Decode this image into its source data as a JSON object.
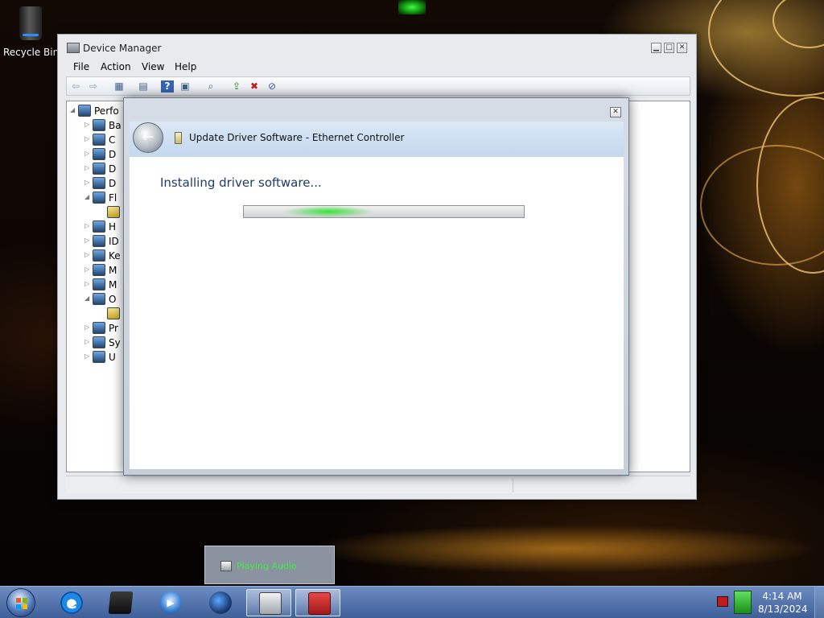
{
  "desktop": {
    "icons": [
      {
        "label": "Recycle Bin",
        "icon": "recycle-bin-icon"
      }
    ]
  },
  "device_manager": {
    "title": "Device Manager",
    "menu": [
      "File",
      "Action",
      "View",
      "Help"
    ],
    "toolbar_icons": [
      "back-arrow-icon",
      "forward-arrow-icon",
      "show-hide-tree-icon",
      "properties-icon",
      "help-icon",
      "console-tree-icon",
      "scan-hardware-icon",
      "update-driver-icon",
      "uninstall-icon",
      "disable-icon"
    ],
    "tree": [
      {
        "label": "Perfo",
        "level": 0,
        "expander": "expanded"
      },
      {
        "label": "Ba",
        "level": 1,
        "expander": "collapsed"
      },
      {
        "label": "C",
        "level": 1,
        "expander": "collapsed"
      },
      {
        "label": "D",
        "level": 1,
        "expander": "collapsed"
      },
      {
        "label": "D",
        "level": 1,
        "expander": "collapsed"
      },
      {
        "label": "D",
        "level": 1,
        "expander": "collapsed"
      },
      {
        "label": "Fl",
        "level": 1,
        "expander": "expanded"
      },
      {
        "label": "",
        "level": 2,
        "expander": "none"
      },
      {
        "label": "H",
        "level": 1,
        "expander": "collapsed"
      },
      {
        "label": "ID",
        "level": 1,
        "expander": "collapsed"
      },
      {
        "label": "Ke",
        "level": 1,
        "expander": "collapsed"
      },
      {
        "label": "M",
        "level": 1,
        "expander": "collapsed"
      },
      {
        "label": "M",
        "level": 1,
        "expander": "collapsed"
      },
      {
        "label": "O",
        "level": 1,
        "expander": "expanded"
      },
      {
        "label": "",
        "level": 2,
        "expander": "none"
      },
      {
        "label": "Pr",
        "level": 1,
        "expander": "collapsed"
      },
      {
        "label": "Sy",
        "level": 1,
        "expander": "collapsed"
      },
      {
        "label": "U",
        "level": 1,
        "expander": "collapsed"
      }
    ]
  },
  "update_dialog": {
    "title": "Update Driver Software - Ethernet Controller",
    "heading": "Installing driver software...",
    "progress_state": "indeterminate"
  },
  "notification": {
    "text": "Playing Audio"
  },
  "taskbar": {
    "apps": [
      {
        "name": "internet-explorer",
        "icon": "internet-explorer-icon",
        "active": false
      },
      {
        "name": "folder",
        "icon": "black-folder-icon",
        "active": false
      },
      {
        "name": "media-player",
        "icon": "media-player-icon",
        "active": false
      },
      {
        "name": "globe",
        "icon": "globe-icon",
        "active": false
      },
      {
        "name": "device-manager",
        "icon": "device-manager-icon",
        "active": true
      },
      {
        "name": "toolbox",
        "icon": "toolbox-icon",
        "active": true
      }
    ],
    "clock": {
      "time": "4:14 AM",
      "date": "8/13/2024"
    }
  }
}
